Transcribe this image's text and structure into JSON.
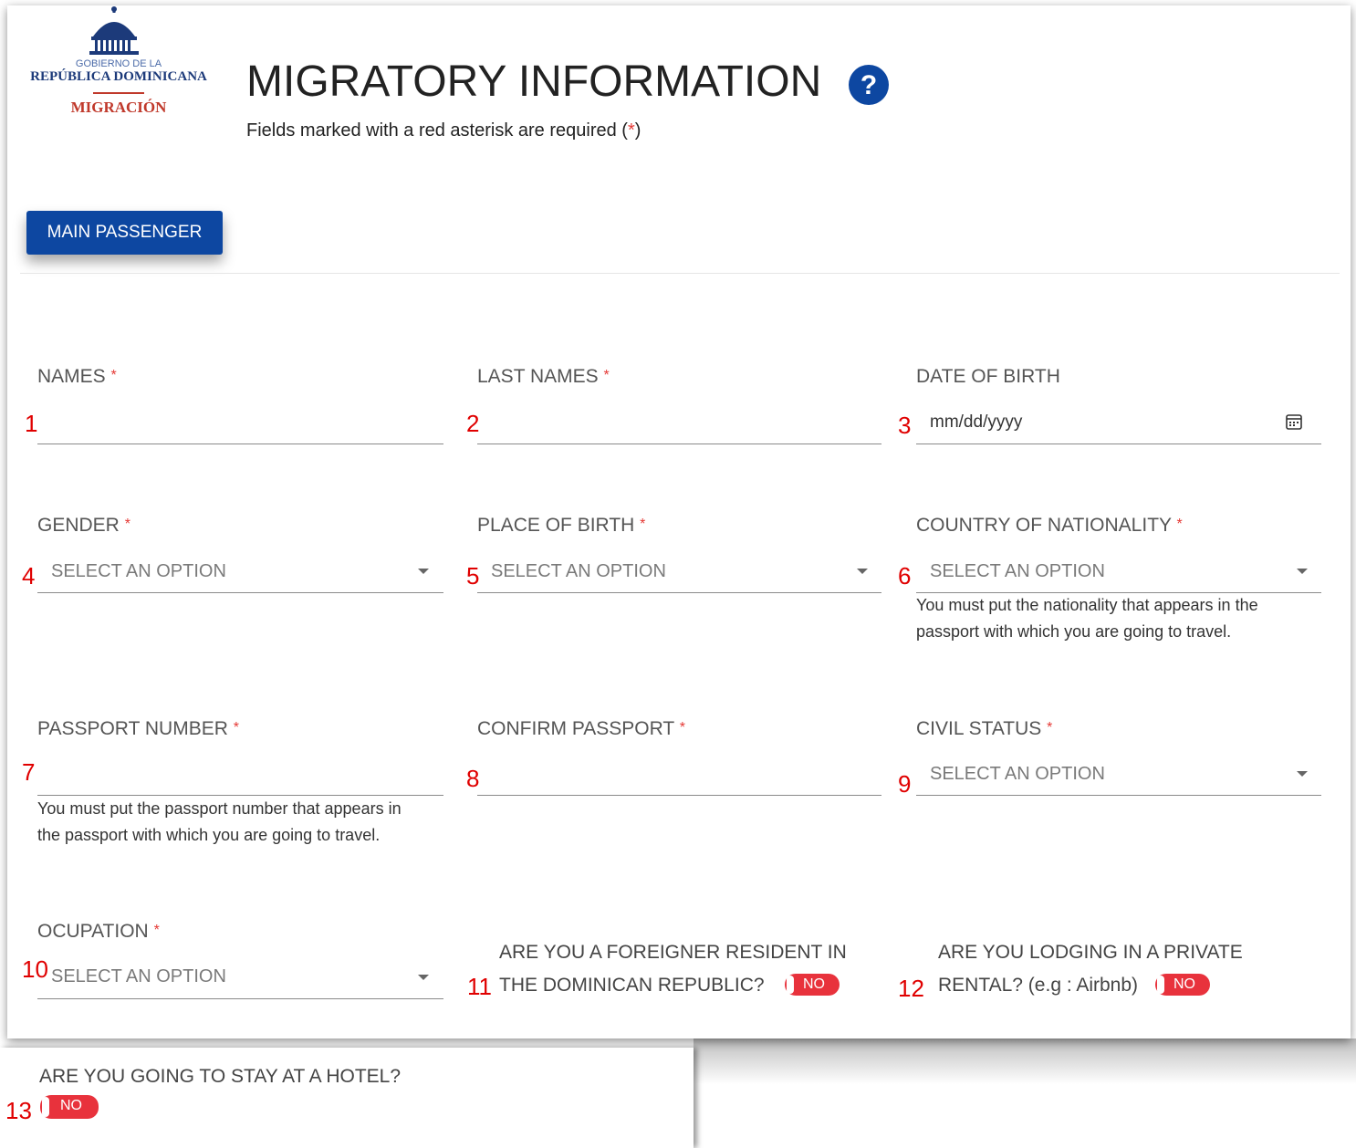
{
  "logo": {
    "line1": "GOBIERNO DE LA",
    "line2": "REPÚBLICA DOMINICANA",
    "line3": "MIGRACIÓN"
  },
  "header": {
    "title": "MIGRATORY INFORMATION",
    "help_icon": "question-circle-icon",
    "subtitle_prefix": "Fields marked with a red asterisk are required (",
    "subtitle_star": "*",
    "subtitle_suffix": ")"
  },
  "tabs": {
    "main_passenger": "MAIN PASSENGER"
  },
  "colors": {
    "primary": "#0d47a1",
    "required": "#e53935",
    "toggle_off": "#e8323c",
    "marker": "#e00000"
  },
  "fields": {
    "names": {
      "label": "NAMES",
      "required": "*",
      "value": "",
      "marker": "1"
    },
    "last_names": {
      "label": "LAST NAMES",
      "required": "*",
      "value": "",
      "marker": "2"
    },
    "date_of_birth": {
      "label": "DATE OF BIRTH",
      "placeholder": "mm/dd/yyyy",
      "icon": "calendar-icon",
      "marker": "3"
    },
    "gender": {
      "label": "GENDER",
      "required": "*",
      "placeholder": "SELECT AN OPTION",
      "marker": "4"
    },
    "place_of_birth": {
      "label": "PLACE OF BIRTH",
      "required": "*",
      "placeholder": "SELECT AN OPTION",
      "marker": "5"
    },
    "country_nationality": {
      "label": "COUNTRY OF NATIONALITY",
      "required": "*",
      "placeholder": "SELECT AN OPTION",
      "marker": "6",
      "help_line1": "You must put the nationality that appears in the",
      "help_line2": "passport with which you are going to travel."
    },
    "passport_number": {
      "label": "PASSPORT NUMBER",
      "required": "*",
      "value": "",
      "marker": "7",
      "help_line1": "You must put the passport number that appears in",
      "help_line2": "the passport with which you are going to travel."
    },
    "confirm_passport": {
      "label": "CONFIRM PASSPORT",
      "required": "*",
      "value": "",
      "marker": "8"
    },
    "civil_status": {
      "label": "CIVIL STATUS",
      "required": "*",
      "placeholder": "SELECT AN OPTION",
      "marker": "9"
    },
    "ocupation": {
      "label": "OCUPATION",
      "required": "*",
      "placeholder": "SELECT AN OPTION",
      "marker": "10"
    },
    "foreigner_resident": {
      "line1": "ARE YOU A FOREIGNER RESIDENT IN",
      "line2": "THE DOMINICAN REPUBLIC?",
      "toggle": "NO",
      "marker": "11"
    },
    "private_rental": {
      "line1": "ARE YOU LODGING IN A PRIVATE",
      "line2": "RENTAL? (e.g : Airbnb)",
      "toggle": "NO",
      "marker": "12"
    },
    "hotel": {
      "question": "ARE YOU GOING TO STAY AT A HOTEL?",
      "toggle": "NO",
      "marker": "13"
    }
  }
}
